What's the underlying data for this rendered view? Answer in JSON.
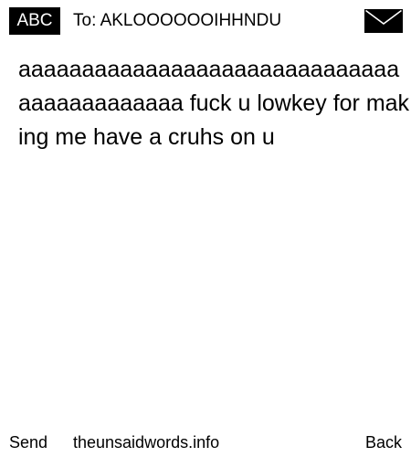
{
  "header": {
    "mode_label": "ABC",
    "recipient": "To: AKLOOOOOOIHHNDU",
    "icon": "envelope-icon"
  },
  "message": {
    "text": "aaaaaaaaaaaaaaaaaaaaaaaaaaaaaaaaaaaaaaaaaaa fuck u lowkey for making me have a cruhs on u"
  },
  "footer": {
    "send_label": "Send",
    "site_label": "theunsaidwords.info",
    "back_label": "Back"
  }
}
